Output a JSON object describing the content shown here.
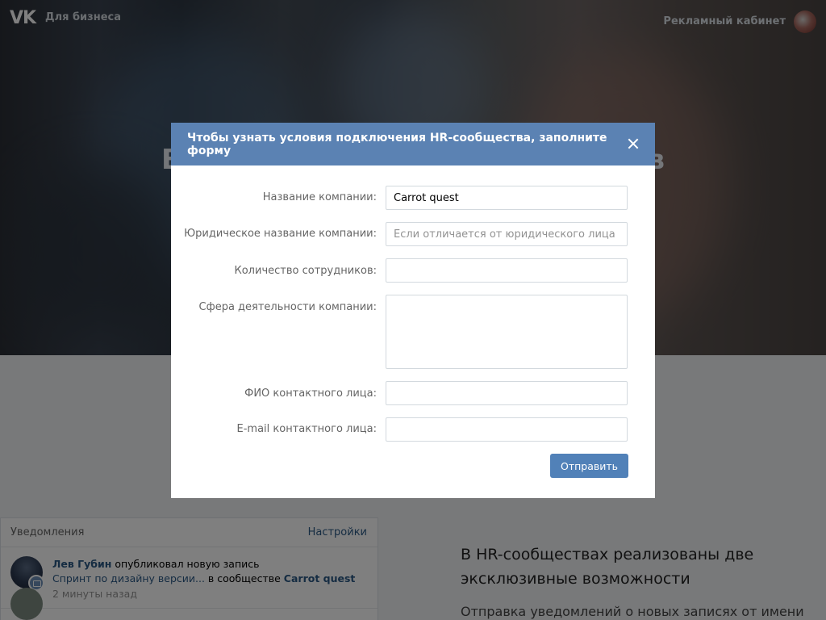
{
  "topbar": {
    "logo_text": "VK",
    "brand": "Для бизнеса",
    "ad_cabinet": "Рекламный кабинет"
  },
  "hero": {
    "title_left": "В",
    "title_right": "в"
  },
  "notifications": {
    "title": "Уведомления",
    "settings": "Настройки",
    "items": [
      {
        "author": "Лев Губин",
        "action": " опубликовал новую запись",
        "post": "Спринт по дизайну версии...",
        "in_community": " в сообществе ",
        "community": "Carrot quest",
        "time": "2 минуты назад"
      }
    ]
  },
  "feature": {
    "title": "В HR-сообществах реализованы две эксклюзивные возможности",
    "text": "Отправка уведомлений о новых записях от имени"
  },
  "modal": {
    "title": "Чтобы узнать условия подключения HR-сообщества, заполните форму",
    "fields": {
      "company_name": {
        "label": "Название компании:",
        "value": "Carrot quest",
        "placeholder": ""
      },
      "legal_name": {
        "label": "Юридическое название компании:",
        "value": "",
        "placeholder": "Если отличается от юридического лица"
      },
      "employees": {
        "label": "Количество сотрудников:",
        "value": "",
        "placeholder": ""
      },
      "sphere": {
        "label": "Сфера деятельности компании:",
        "value": "",
        "placeholder": ""
      },
      "contact_name": {
        "label": "ФИО контактного лица:",
        "value": "",
        "placeholder": ""
      },
      "contact_email": {
        "label": "E-mail контактного лица:",
        "value": "",
        "placeholder": ""
      }
    },
    "submit_label": "Отправить"
  }
}
